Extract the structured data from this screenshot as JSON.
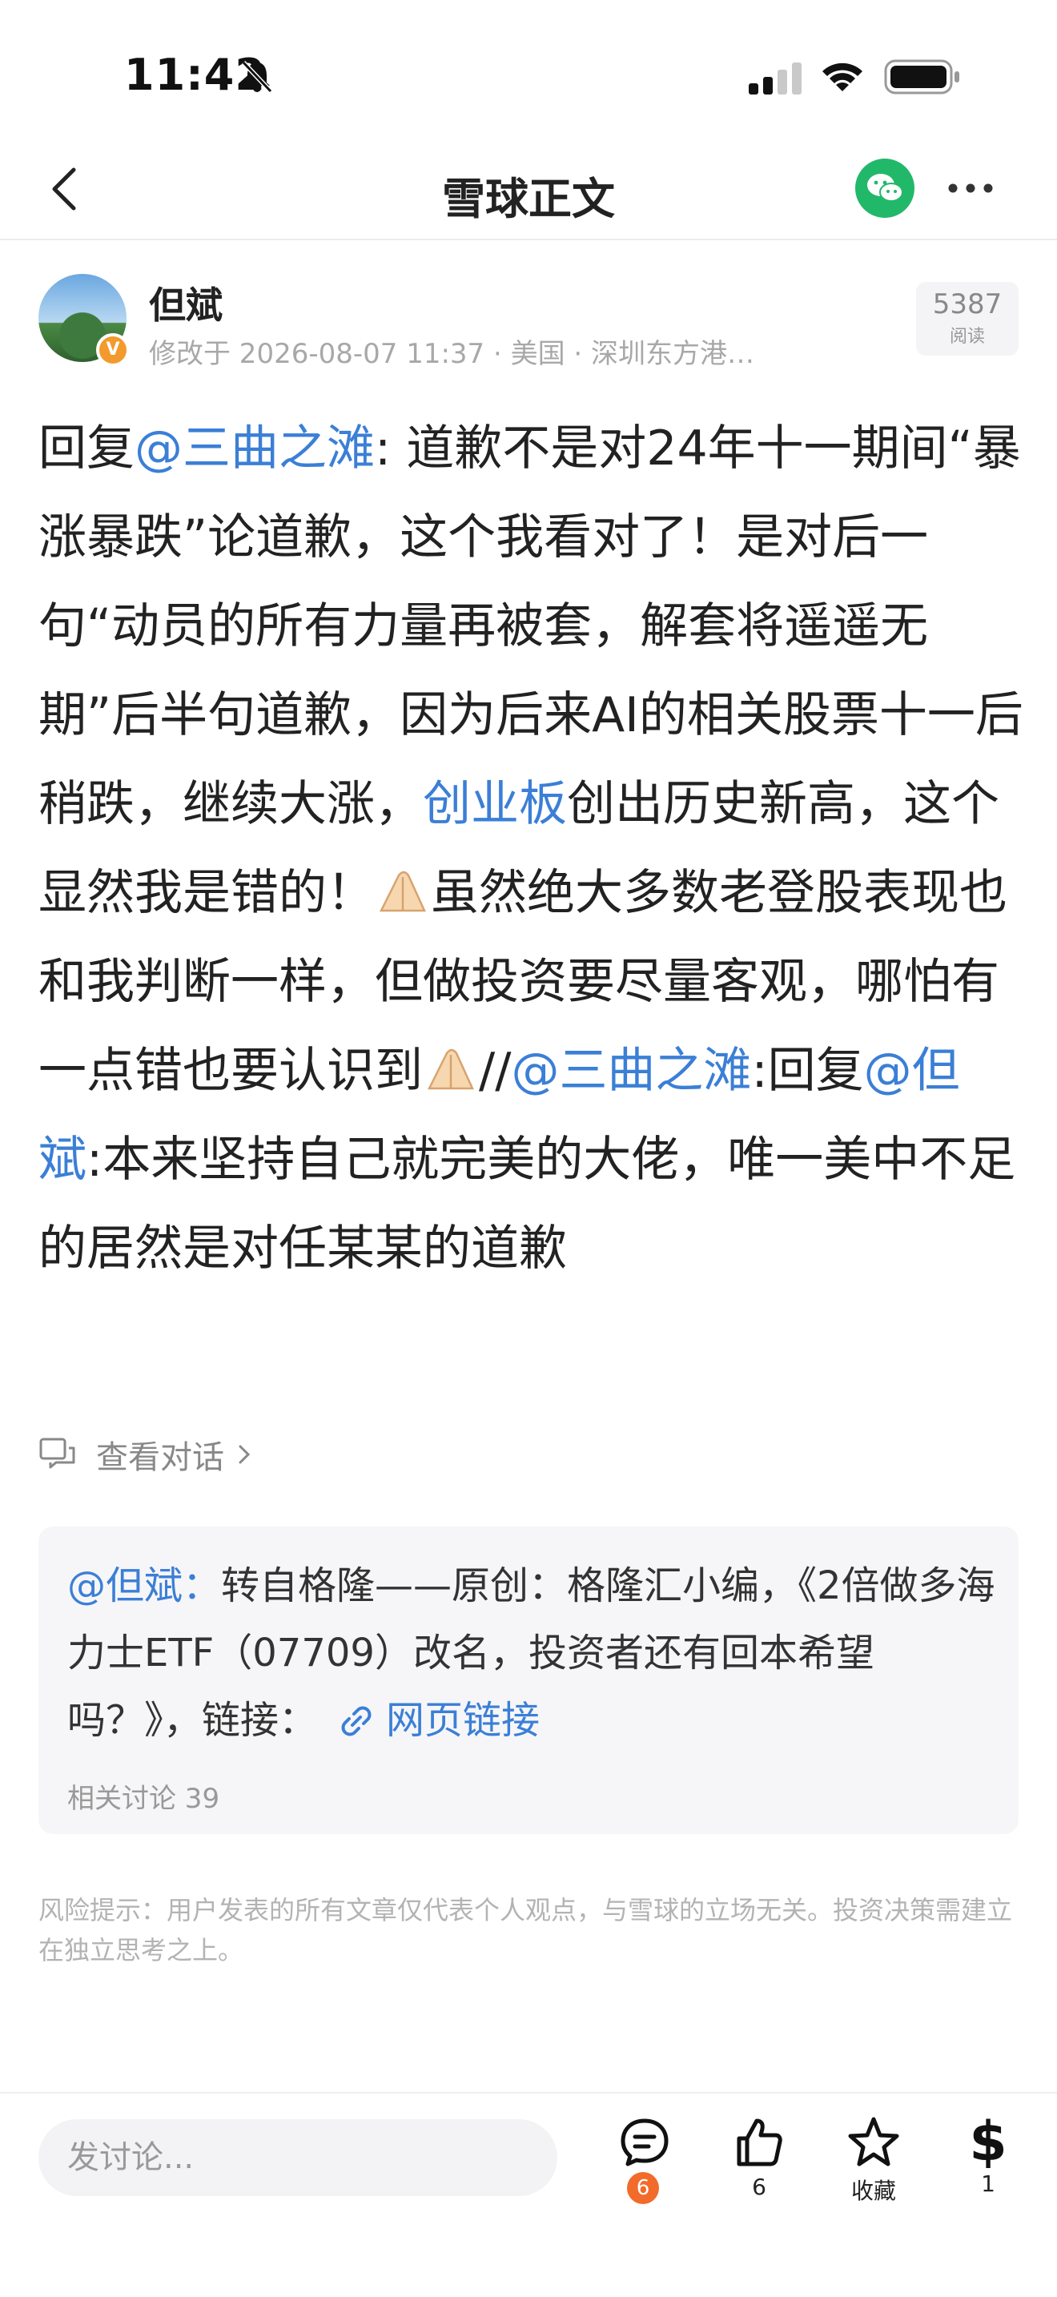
{
  "status_bar": {
    "time": "11:42"
  },
  "nav": {
    "title": "雪球正文"
  },
  "author": {
    "name": "但斌",
    "badge": "V",
    "meta": "修改于 2026-08-07 11:37 · 美国 · 深圳东方港…",
    "read_count": "5387",
    "read_label": "阅读"
  },
  "post": {
    "p1": "回复",
    "m1": "@三曲之滩",
    "p2": ": 道歉不是对24年十一期间“暴涨暴跌”论道歉，这个我看对了！是对后一句“动员的所有力量再被套，解套将遥遥无期”后半句道歉，因为后来AI的相关股票十一后稍跌，继续大涨，",
    "m2": "创业板",
    "p3": "创出历史新高，这个显然我是错的！",
    "p4": "虽然绝大多数老登股表现也和我判断一样，但做投资要尽量客观，哪怕有一点错也要认识到",
    "p5": "//",
    "m3": "@三曲之滩",
    "p6": ":回复",
    "m4": "@但斌",
    "p7": ":本来坚持自己就完美的大佬，唯一美中不足的居然是对任某某的道歉"
  },
  "view_dialog": {
    "label": "查看对话"
  },
  "quote": {
    "mention": "@但斌：",
    "text": "转自格隆——原创：格隆汇小编，《2倍做多海力士ETF（07709）改名，投资者还有回本希望吗？》，链接：",
    "link_label": "网页链接",
    "related": "相关讨论 39"
  },
  "risk_notice": "风险提示：用户发表的所有文章仅代表个人观点，与雪球的立场无关。投资决策需建立在独立思考之上。",
  "bottom_bar": {
    "input_placeholder": "发讨论...",
    "comment_count": "6",
    "like_count": "6",
    "favorite_label": "收藏",
    "reward_symbol": "$",
    "reward_count": "1"
  },
  "colors": {
    "link": "#3b7fd6",
    "wechat": "#22b86a",
    "badge": "#f26b2a"
  }
}
